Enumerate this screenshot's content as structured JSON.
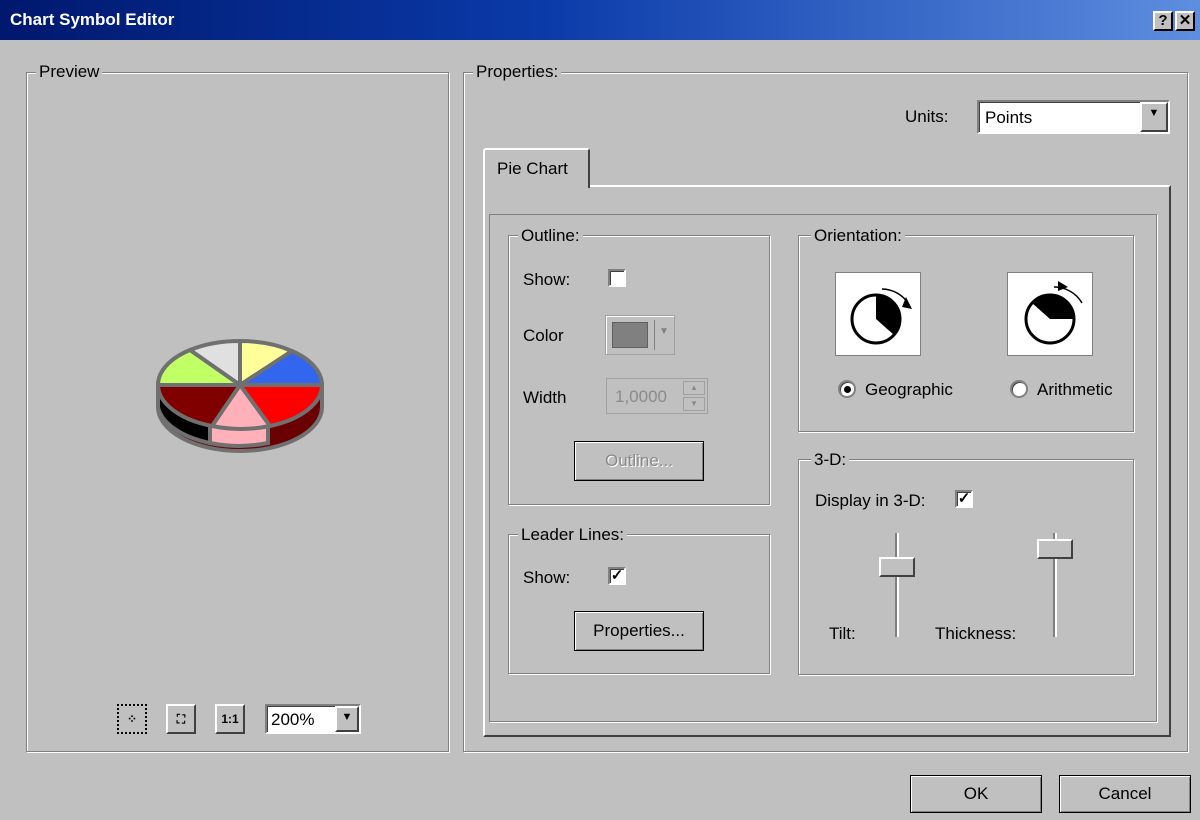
{
  "window": {
    "title": "Chart Symbol Editor",
    "help_label": "?",
    "close_label": "✕"
  },
  "preview": {
    "label": "Preview",
    "zoom_value": "200%",
    "toolbar": [
      {
        "icon": "zoom-in-icon",
        "glyph": "⁘"
      },
      {
        "icon": "zoom-out-icon",
        "glyph": "⛶"
      },
      {
        "icon": "actual-size-icon",
        "glyph": "1:1"
      }
    ],
    "pie_colors": [
      "#e0e0e0",
      "#ffff99",
      "#3366ee",
      "#ff0000",
      "#ffb0b8",
      "#800000",
      "#c0ff66"
    ]
  },
  "properties": {
    "label": "Properties:",
    "units_label": "Units:",
    "units_value": "Points",
    "tab_label": "Pie Chart",
    "outline": {
      "label": "Outline:",
      "show_label": "Show:",
      "show_checked": false,
      "color_label": "Color",
      "width_label": "Width",
      "width_value": "1,0000",
      "button_label": "Outline..."
    },
    "leader_lines": {
      "label": "Leader Lines:",
      "show_label": "Show:",
      "show_checked": true,
      "button_label": "Properties..."
    },
    "orientation": {
      "label": "Orientation:",
      "geographic_label": "Geographic",
      "arithmetic_label": "Arithmetic",
      "selected": "Geographic"
    },
    "three_d": {
      "label": "3-D:",
      "display_label": "Display in 3-D:",
      "display_checked": true,
      "tilt_label": "Tilt:",
      "thickness_label": "Thickness:"
    }
  },
  "footer": {
    "ok_label": "OK",
    "cancel_label": "Cancel"
  },
  "colors": {
    "title_start": "#00186e",
    "title_end": "#5d8ee0",
    "face": "#c0c0c0"
  }
}
